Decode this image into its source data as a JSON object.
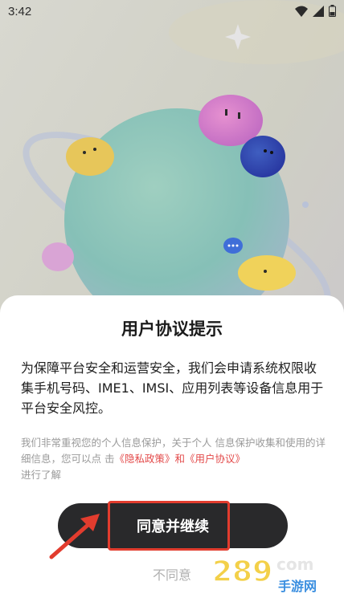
{
  "status": {
    "time": "3:42"
  },
  "dialog": {
    "title": "用户协议提示",
    "main_text": "为保障平台安全和运营安全，我们会申请系统权限收集手机号码、IME1、IMSI、应用列表等设备信息用于平台安全风控。",
    "sub_text_before": "我们非常重视您的个人信息保护，关于个人 信息保护收集和使用的详细信息，您可以点 击",
    "privacy_link": "《隐私政策》",
    "and_text": "和",
    "agreement_link": "《用户协议》",
    "sub_text_after": "进行了解",
    "agree_label": "同意并继续",
    "disagree_label": "不同意"
  },
  "watermark": {
    "number": "289",
    "suffix": "com",
    "caption": "手游网"
  },
  "colors": {
    "button": "#29292b",
    "link": "#e34a4a",
    "highlight": "#e23c2e"
  },
  "icons": [
    "wifi-icon",
    "signal-icon",
    "battery-icon",
    "pointer-arrow"
  ]
}
